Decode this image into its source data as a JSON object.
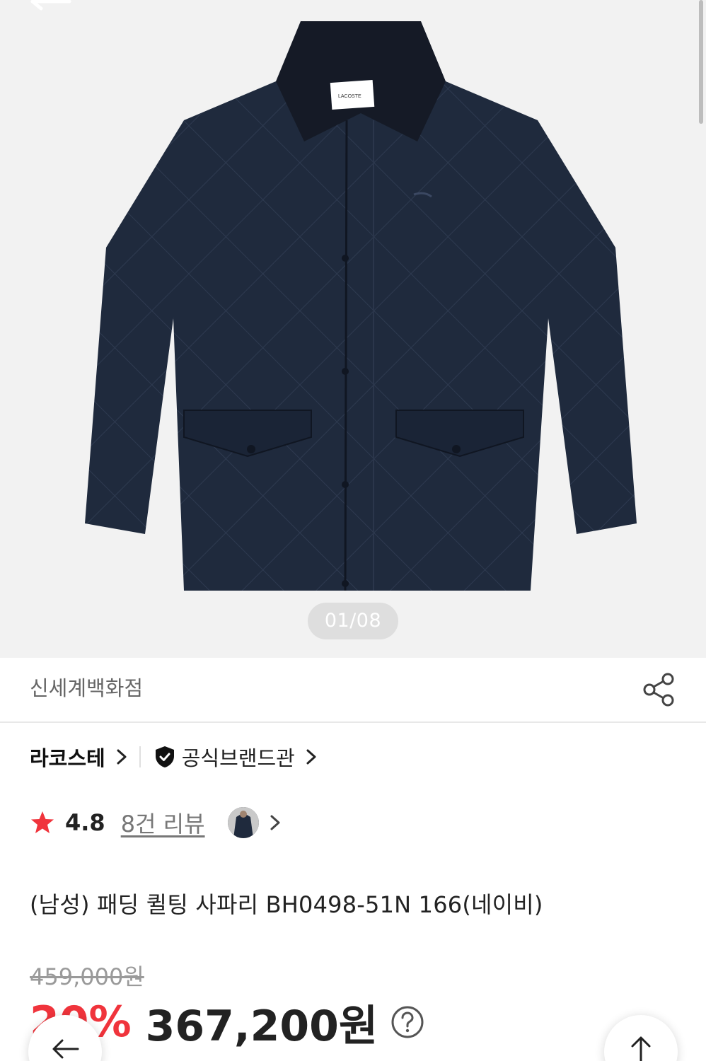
{
  "gallery": {
    "pager": "01/08",
    "image_alt": "navy quilted jacket",
    "label_brand": "LACOSTE"
  },
  "store": {
    "name": "신세계백화점"
  },
  "brand": {
    "name": "라코스테",
    "official_label": "공식브랜드관"
  },
  "rating": {
    "score": "4.8",
    "reviews_label": "8건 리뷰"
  },
  "product": {
    "title": "(남성) 패딩 퀼팅 사파리 BH0498-51N 166(네이비)",
    "original_price": "459,000원",
    "discount": "20%",
    "price": "367,200원"
  },
  "icons": {
    "back": "arrow-left-icon",
    "share": "share-icon",
    "chevron": "chevron-right-icon",
    "shield": "shield-check-icon",
    "star": "star-icon",
    "help": "question-circle-icon",
    "top": "arrow-up-icon"
  },
  "colors": {
    "accent": "#f0343c",
    "hero_bg": "#f2f2f2",
    "jacket": "#1f2a3d",
    "collar": "#151a26"
  }
}
